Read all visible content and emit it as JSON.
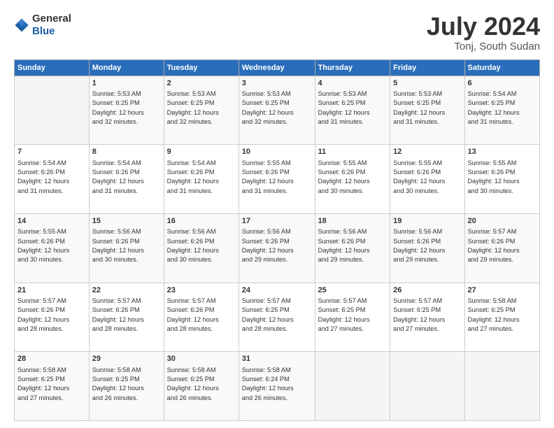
{
  "header": {
    "logo_general": "General",
    "logo_blue": "Blue",
    "title": "July 2024",
    "subtitle": "Tonj, South Sudan"
  },
  "days_of_week": [
    "Sunday",
    "Monday",
    "Tuesday",
    "Wednesday",
    "Thursday",
    "Friday",
    "Saturday"
  ],
  "weeks": [
    [
      {
        "num": "",
        "info": ""
      },
      {
        "num": "1",
        "info": "Sunrise: 5:53 AM\nSunset: 6:25 PM\nDaylight: 12 hours\nand 32 minutes."
      },
      {
        "num": "2",
        "info": "Sunrise: 5:53 AM\nSunset: 6:25 PM\nDaylight: 12 hours\nand 32 minutes."
      },
      {
        "num": "3",
        "info": "Sunrise: 5:53 AM\nSunset: 6:25 PM\nDaylight: 12 hours\nand 32 minutes."
      },
      {
        "num": "4",
        "info": "Sunrise: 5:53 AM\nSunset: 6:25 PM\nDaylight: 12 hours\nand 31 minutes."
      },
      {
        "num": "5",
        "info": "Sunrise: 5:53 AM\nSunset: 6:25 PM\nDaylight: 12 hours\nand 31 minutes."
      },
      {
        "num": "6",
        "info": "Sunrise: 5:54 AM\nSunset: 6:25 PM\nDaylight: 12 hours\nand 31 minutes."
      }
    ],
    [
      {
        "num": "7",
        "info": "Sunrise: 5:54 AM\nSunset: 6:26 PM\nDaylight: 12 hours\nand 31 minutes."
      },
      {
        "num": "8",
        "info": "Sunrise: 5:54 AM\nSunset: 6:26 PM\nDaylight: 12 hours\nand 31 minutes."
      },
      {
        "num": "9",
        "info": "Sunrise: 5:54 AM\nSunset: 6:26 PM\nDaylight: 12 hours\nand 31 minutes."
      },
      {
        "num": "10",
        "info": "Sunrise: 5:55 AM\nSunset: 6:26 PM\nDaylight: 12 hours\nand 31 minutes."
      },
      {
        "num": "11",
        "info": "Sunrise: 5:55 AM\nSunset: 6:26 PM\nDaylight: 12 hours\nand 30 minutes."
      },
      {
        "num": "12",
        "info": "Sunrise: 5:55 AM\nSunset: 6:26 PM\nDaylight: 12 hours\nand 30 minutes."
      },
      {
        "num": "13",
        "info": "Sunrise: 5:55 AM\nSunset: 6:26 PM\nDaylight: 12 hours\nand 30 minutes."
      }
    ],
    [
      {
        "num": "14",
        "info": "Sunrise: 5:55 AM\nSunset: 6:26 PM\nDaylight: 12 hours\nand 30 minutes."
      },
      {
        "num": "15",
        "info": "Sunrise: 5:56 AM\nSunset: 6:26 PM\nDaylight: 12 hours\nand 30 minutes."
      },
      {
        "num": "16",
        "info": "Sunrise: 5:56 AM\nSunset: 6:26 PM\nDaylight: 12 hours\nand 30 minutes."
      },
      {
        "num": "17",
        "info": "Sunrise: 5:56 AM\nSunset: 6:26 PM\nDaylight: 12 hours\nand 29 minutes."
      },
      {
        "num": "18",
        "info": "Sunrise: 5:56 AM\nSunset: 6:26 PM\nDaylight: 12 hours\nand 29 minutes."
      },
      {
        "num": "19",
        "info": "Sunrise: 5:56 AM\nSunset: 6:26 PM\nDaylight: 12 hours\nand 29 minutes."
      },
      {
        "num": "20",
        "info": "Sunrise: 5:57 AM\nSunset: 6:26 PM\nDaylight: 12 hours\nand 29 minutes."
      }
    ],
    [
      {
        "num": "21",
        "info": "Sunrise: 5:57 AM\nSunset: 6:26 PM\nDaylight: 12 hours\nand 28 minutes."
      },
      {
        "num": "22",
        "info": "Sunrise: 5:57 AM\nSunset: 6:26 PM\nDaylight: 12 hours\nand 28 minutes."
      },
      {
        "num": "23",
        "info": "Sunrise: 5:57 AM\nSunset: 6:26 PM\nDaylight: 12 hours\nand 28 minutes."
      },
      {
        "num": "24",
        "info": "Sunrise: 5:57 AM\nSunset: 6:25 PM\nDaylight: 12 hours\nand 28 minutes."
      },
      {
        "num": "25",
        "info": "Sunrise: 5:57 AM\nSunset: 6:25 PM\nDaylight: 12 hours\nand 27 minutes."
      },
      {
        "num": "26",
        "info": "Sunrise: 5:57 AM\nSunset: 6:25 PM\nDaylight: 12 hours\nand 27 minutes."
      },
      {
        "num": "27",
        "info": "Sunrise: 5:58 AM\nSunset: 6:25 PM\nDaylight: 12 hours\nand 27 minutes."
      }
    ],
    [
      {
        "num": "28",
        "info": "Sunrise: 5:58 AM\nSunset: 6:25 PM\nDaylight: 12 hours\nand 27 minutes."
      },
      {
        "num": "29",
        "info": "Sunrise: 5:58 AM\nSunset: 6:25 PM\nDaylight: 12 hours\nand 26 minutes."
      },
      {
        "num": "30",
        "info": "Sunrise: 5:58 AM\nSunset: 6:25 PM\nDaylight: 12 hours\nand 26 minutes."
      },
      {
        "num": "31",
        "info": "Sunrise: 5:58 AM\nSunset: 6:24 PM\nDaylight: 12 hours\nand 26 minutes."
      },
      {
        "num": "",
        "info": ""
      },
      {
        "num": "",
        "info": ""
      },
      {
        "num": "",
        "info": ""
      }
    ]
  ]
}
